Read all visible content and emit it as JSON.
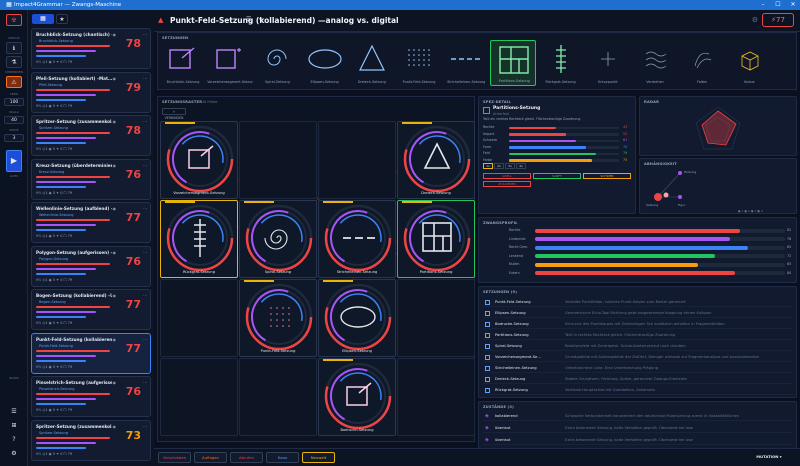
{
  "window": {
    "title": "Impact4Grammar — Zwangs-Maschine"
  },
  "rail": {
    "labels": [
      "MODUS",
      "VERBINDEN",
      "SEED",
      "SKALA",
      "MODE",
      "ACHS"
    ],
    "values": [
      "100",
      "40",
      "3"
    ],
    "bottom": [
      "ZOOM",
      "RANDOM"
    ]
  },
  "list": [
    {
      "title": "Bruchblick-Setzung (chantisch) –…",
      "sub": "Bruchblick-Setzung",
      "score": "78",
      "color": "#ef4444",
      "meta": "⟳1 ◎1 ◉ 5 ✦ 0  ☐ 79"
    },
    {
      "title": "Pfeil-Setzung (kollabiert) –Mat…",
      "sub": "Pfeil-Setzung",
      "score": "79",
      "color": "#ef4444",
      "meta": "⟳1 ◎1 ◉ 5 ✦ 0  ☐ 79"
    },
    {
      "title": "Spritzer-Setzung (zusammenkol…",
      "sub": "Spritzer-Setzung",
      "score": "78",
      "color": "#ef4444",
      "meta": "⟳1 ◎1 ◉ 5 ✦ 0  ☐ 79"
    },
    {
      "title": "Kreuz-Setzung (überdeterminiert)…",
      "sub": "Kreuz-Setzung",
      "score": "76",
      "color": "#ef4444",
      "meta": "⟳1 ◎1 ◉ 5 ✦ 0  ☐ 79"
    },
    {
      "title": "Wellenlinie-Setzung (aufblend) –…",
      "sub": "Wellenlinie-Setzung",
      "score": "77",
      "color": "#ef4444",
      "meta": "⟳1 ◎1 ◉ 5 ✦ 0  ☐ 79"
    },
    {
      "title": "Polygon-Setzung (aufgerissen) –…",
      "sub": "Polygon-Setzung",
      "score": "76",
      "color": "#ef4444",
      "meta": "⟳1 ◎1 ◉ 5 ✦ 0  ☐ 79"
    },
    {
      "title": "Bogen-Setzung (kollabierend) –U…",
      "sub": "Bogen-Setzung",
      "score": "77",
      "color": "#ef4444",
      "meta": "⟳1 ◎1 ◉ 5 ✦ 0  ☐ 79"
    },
    {
      "title": "Punkt-Feld-Setzung (kollabierend)…",
      "sub": "Punkt-Feld-Setzung",
      "score": "77",
      "color": "#ef4444",
      "meta": "⟳1 ◎1 ◉ 5 ✦ 0  ☐ 79"
    },
    {
      "title": "Pinselstrich-Setzung (aufgerissen)…",
      "sub": "Pinselstrich-Setzung",
      "score": "76",
      "color": "#ef4444",
      "meta": "⟳1 ◎1 ◉ 5 ✦ 0  ☐ 79"
    },
    {
      "title": "Spritzer-Setzung (zusammenkol…",
      "sub": "Spritzer-Setzung",
      "score": "73",
      "color": "#f59e0b",
      "meta": "⟳1 ◎1 ◉ 5 ✦ 0  ☐ 79"
    }
  ],
  "header": {
    "title": "Punkt-Feld-Setzung (kollabierend) —analog vs. digital",
    "score": "⚡77"
  },
  "strip": {
    "label": "SETZUNGEN",
    "tools": [
      "Bruchblick-Setzung",
      "Vorzeichensegment-Setzung",
      "Spiral-Setzung",
      "Ellipsen-Setzung",
      "Dreieck-Setzung",
      "Punkt-Feld-Setzung",
      "Strichelleinen-Setzung",
      "Partitions-Setzung",
      "Rückgrat-Setzung",
      "Kreuzpunkt",
      "Verdrehen",
      "Falten",
      "Kubus"
    ]
  },
  "canvas": {
    "label": "SETZUNGSRASTER",
    "sub": "16 Felder",
    "btn": "+ VERBINDEN",
    "cells": [
      "Vorzeichensegment-Setzung",
      "Dreieck-Setzung",
      "Rückgrat-Setzung",
      "Spiral-Setzung",
      "Strichelleinen-Setzung",
      "Partitions-Setzung",
      "Punkt-Feld-Setzung",
      "Ellipsen-Setzung",
      "Bodruckn-Setzung"
    ]
  },
  "detail": {
    "label": "SPEZ-DETAIL",
    "name": "Partitions-Setzung",
    "sub": "Ankerfeld",
    "desc": "Teilt ein rechtes Rechteck gleich. Flächentrochige Zuordnung",
    "metrics": [
      {
        "k": "Rechte",
        "v": "43",
        "c": "#ef4444"
      },
      {
        "k": "Impact",
        "v": "52",
        "c": "#ef4444"
      },
      {
        "k": "Schwere",
        "v": "61",
        "c": "#a855f7"
      },
      {
        "k": "Form",
        "v": "70",
        "c": "#3b82f6"
      },
      {
        "k": "Feld",
        "v": "79",
        "c": "#22c55e"
      },
      {
        "k": "Farbe",
        "v": "75",
        "c": "#f59e0b"
      }
    ],
    "tabs": [
      "1x",
      "2x",
      "3x",
      "4x"
    ],
    "chips": [
      "GRELL",
      "SANFT",
      "SCHWER",
      "ZUSAMMEN"
    ]
  },
  "radar": {
    "label": "RADAR"
  },
  "net": {
    "label": "ABHÄNGIGKEIT",
    "nodes": [
      "Wirkung",
      "Setzung",
      "Figur"
    ],
    "legend": "● 1 ● 2 ● 3 ● 4"
  },
  "profile": {
    "label": "ZWANGSPROFIL",
    "rows": [
      {
        "k": "Rechte",
        "v": "82",
        "c": "#ef4444"
      },
      {
        "k": "Lindernde",
        "v": "78",
        "c": "#a855f7"
      },
      {
        "k": "Recht Gem.",
        "v": "85",
        "c": "#3b82f6"
      },
      {
        "k": "Lenkend",
        "v": "72",
        "c": "#22c55e"
      },
      {
        "k": "Nullen",
        "v": "65",
        "c": "#f59e0b"
      },
      {
        "k": "Extern",
        "v": "80",
        "c": "#ef4444"
      }
    ]
  },
  "gen": {
    "label": "SETZUNGEN (9)",
    "rows": [
      {
        "n": "Punkt-Feld-Setzung",
        "d": "Verteilte Punktfelder, isolierte Punkt-Setzen zum Raster generiert"
      },
      {
        "n": "Ellipsen-Setzung",
        "d": "Geometrische Echo-Topi Richtung gebt ausgebremste Kopplung drinen Kulissen"
      },
      {
        "n": "Bodrucke-Setzung",
        "d": "Schrunnt des Punktkorpes mit Zellenslagen Sch zusätzlich anhalten in Fragmentbilden"
      },
      {
        "n": "Partitions-Setzung",
        "d": "Teilt in rechtes Rechteck gleich. Flächentrochige Zuordnung"
      },
      {
        "n": "Spiral-Setzung",
        "d": "Rotationsfeld mit Zentripetal. Schub-Kantenverlauf nach draußen"
      },
      {
        "n": "Vorzeichensegment-Se…",
        "d": "Grundgebilde mit Außengebilde der Zuführt, Weniger wirksam zur Fragmentanalyse und auszutrekenden"
      },
      {
        "n": "Strichelleinen-Setzung",
        "d": "Unterbrochene Linie. Eine Unterbrechung Prägung"
      },
      {
        "n": "Dreieck-Setzung",
        "d": "Stabile Grundform. Richtung, Spitze, gerecnete Zwangs-Elemente"
      },
      {
        "n": "Rückgrat-Setzung",
        "d": "Vertikale Hauptachse mit Querbalken, Ankernetz."
      }
    ]
  },
  "states": {
    "label": "ZUSTÄNDE (3)",
    "rows": [
      {
        "n": "kollabierend",
        "d": "Schwache Verbundenheit konzentriert den deutlichste Polarisierung zuerst in Instabilitätlichen"
      },
      {
        "n": "überlaut",
        "d": "Extra betonende Setzung, kalte Verhalten geprüft. Übersiede kei lose"
      },
      {
        "n": "überlaut",
        "d": "Extra betonende Setzung, kalte Verhalten geprüft. Übersiede kei lose"
      }
    ]
  },
  "bottom": {
    "buttons": [
      "Verschieben",
      "Auflegen",
      "Abrufen",
      "Kaus",
      "Neuwelt"
    ],
    "mutation": "MUTATION ▾"
  }
}
